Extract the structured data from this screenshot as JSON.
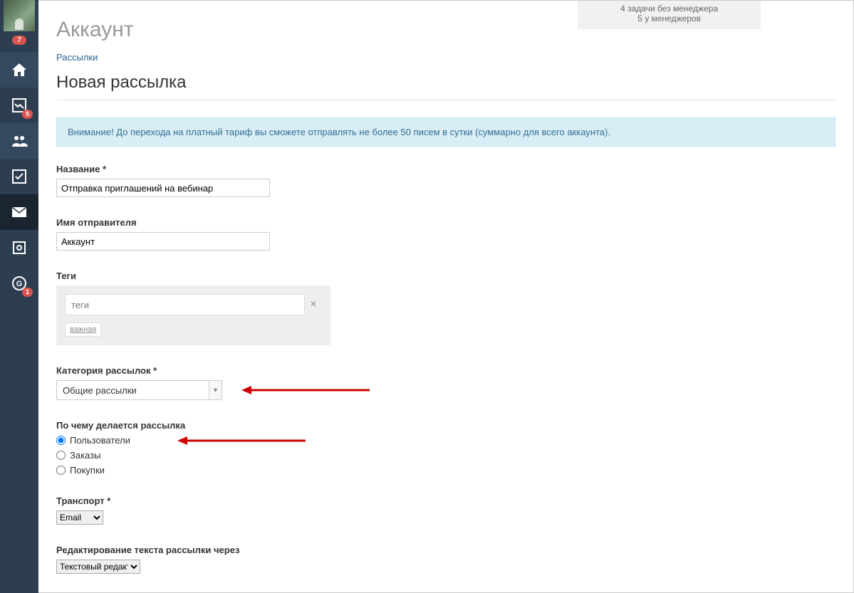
{
  "top_banner": {
    "line1": "4 задачи без менеджера",
    "line2": "5 у менеджеров"
  },
  "sidebar": {
    "badge_top": "7",
    "badge_chart": "5",
    "badge_gc": "1"
  },
  "page": {
    "title": "Аккаунт",
    "breadcrumb": "Рассылки",
    "section_title": "Новая рассылка"
  },
  "alert": "Внимание! До перехода на платный тариф вы сможете отправлять не более 50 писем в сутки (суммарно для всего аккаунта).",
  "form": {
    "name_label": "Название *",
    "name_value": "Отправка приглашений на вебинар",
    "sender_label": "Имя отправителя",
    "sender_value": "Аккаунт",
    "tags_label": "Теги",
    "tags_placeholder": "теги",
    "tag_chip": "важная",
    "category_label": "Категория рассылок *",
    "category_value": "Общие рассылки",
    "target_label": "По чему делается рассылка",
    "target_opt1": "Пользователи",
    "target_opt2": "Заказы",
    "target_opt3": "Покупки",
    "transport_label": "Транспорт *",
    "transport_value": "Email",
    "editor_label": "Редактирование текста рассылки через",
    "editor_value": "Текстовый редактор"
  }
}
